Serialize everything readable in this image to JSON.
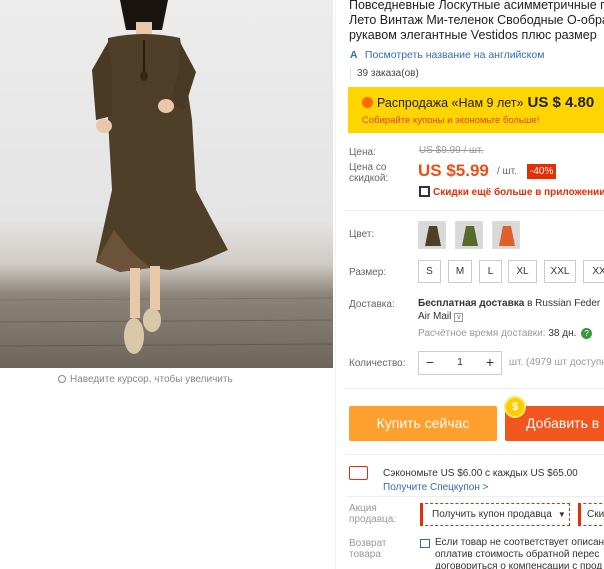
{
  "gallery": {
    "zoom_hint": "Наведите курсор, чтобы увеличить"
  },
  "product": {
    "title_line1": "Повседневные Лоскутные асимметричные п",
    "title_line2": "Лето Винтаж Ми-теленок Свободные О-обра",
    "title_line3": "рукавом элегантные Vestidos плюс размер",
    "translate_link": "Посмотреть название на английском",
    "orders": "39 заказа(ов)"
  },
  "promo": {
    "label": "Распродажа «Нам 9 лет»",
    "price": "US $ 4.80",
    "sub": "Собирайте купоны и экономьте больше!"
  },
  "price": {
    "label_old": "Цена:",
    "old": "US $9.99 / шт.",
    "label_discount_1": "Цена со",
    "label_discount_2": "скидкой:",
    "current": "US $5.99",
    "unit": "/ шт.",
    "discount_badge": "-40%",
    "app_note": "Скидки ещё больше в приложении"
  },
  "color": {
    "label": "Цвет:",
    "options": [
      "brown",
      "green",
      "orange"
    ]
  },
  "size": {
    "label": "Размер:",
    "options": [
      "S",
      "M",
      "L",
      "XL",
      "XXL",
      "XX"
    ]
  },
  "shipping": {
    "label": "Доставка:",
    "free": "Бесплатная доставка",
    "to": "в Russian Feder",
    "method": "Air Mail",
    "time_label": "Расчётное время доставки:",
    "time_value": "38 дн."
  },
  "quantity": {
    "label": "Количество:",
    "value": "1",
    "minus": "−",
    "plus": "+",
    "available": "шт. (4979 шт доступно"
  },
  "actions": {
    "buy_now": "Купить сейчас",
    "add_to_cart": "Добавить в"
  },
  "coupon": {
    "save_text": "Сэкономьте US $6.00 с каждых US $65.00",
    "get_link": "Получите Спецкупон >"
  },
  "seller_promo": {
    "label_1": "Акция",
    "label_2": "продавца:",
    "button": "Получить купон продавца",
    "button2": "Ски"
  },
  "returns": {
    "label_1": "Возврат",
    "label_2": "товара",
    "text_1": "Если товар не соответствует описан",
    "text_2": "оплатив стоимость обратной перес",
    "text_3": "договориться о компенсации с прод"
  },
  "colors": {
    "accent": "#f04d14",
    "promo_bg": "#ffd500",
    "buy_btn": "#ff9f2d",
    "cart_btn": "#f0561d",
    "link": "#2f6fb5"
  }
}
